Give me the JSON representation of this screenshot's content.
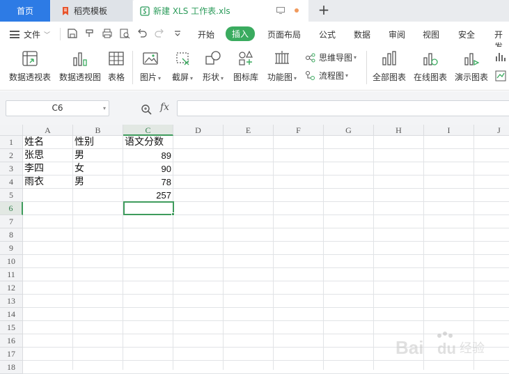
{
  "tabs": {
    "home": "首页",
    "docer": "稻壳模板",
    "file": "新建 XLS 工作表.xls",
    "new_tab": "+"
  },
  "menu": {
    "file": "文件",
    "items": [
      "开始",
      "插入",
      "页面布局",
      "公式",
      "数据",
      "审阅",
      "视图",
      "安全",
      "开发"
    ],
    "active": "插入"
  },
  "ribbon": {
    "pivot_table": "数据透视表",
    "pivot_chart": "数据透视图",
    "table": "表格",
    "picture": "图片",
    "screenshot": "截屏",
    "shape": "形状",
    "icon_lib": "图标库",
    "func_chart": "功能图",
    "mind_map": "思维导图",
    "flow_chart": "流程图",
    "all_charts": "全部图表",
    "online_charts": "在线图表",
    "demo_charts": "演示图表"
  },
  "formula_bar": {
    "name_box": "C6",
    "fx": "fx",
    "formula": ""
  },
  "sheet": {
    "columns": [
      "A",
      "B",
      "C",
      "D",
      "E",
      "F",
      "G",
      "H",
      "I",
      "J"
    ],
    "rows": [
      "1",
      "2",
      "3",
      "4",
      "5",
      "6",
      "7",
      "8",
      "9",
      "10",
      "11",
      "12",
      "13",
      "14",
      "15",
      "16",
      "17",
      "18"
    ],
    "selected_cell": "C6",
    "cells": {
      "A1": "姓名",
      "B1": "性别",
      "C1": "语文分数",
      "A2": "张思",
      "B2": "男",
      "C2": "89",
      "A3": "李四",
      "B3": "女",
      "C3": "90",
      "A4": "雨衣",
      "B4": "男",
      "C4": "78",
      "C5": "257"
    }
  },
  "watermark": "Baidu 经验",
  "colors": {
    "accent_green": "#3aab5f",
    "home_tab_blue": "#2d7be5",
    "selection_green": "#3e9b5c"
  }
}
